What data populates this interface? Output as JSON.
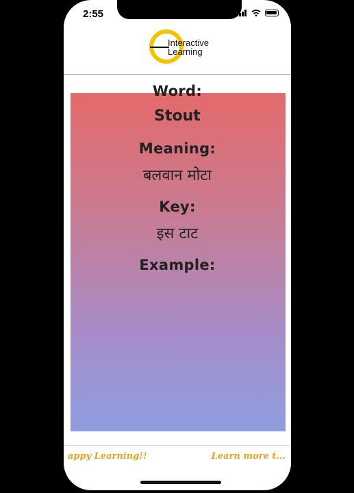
{
  "status_bar": {
    "time": "2:55",
    "icons": [
      "signal-icon",
      "wifi-icon",
      "battery-icon"
    ]
  },
  "header": {
    "logo_icon": "interactive-learning-logo",
    "logo_line1": "Interactive",
    "logo_line2": "Learning",
    "logo_ring_color": "#f5c400"
  },
  "card": {
    "word_label": "Word:",
    "word_value": "Stout",
    "meaning_label": "Meaning:",
    "meaning_value": "बलवान मोटा",
    "key_label": "Key:",
    "key_value": "इस टाट",
    "example_label": "Example:",
    "example_value": "",
    "gradient_top": "#e46a6b",
    "gradient_bottom": "#8f9de0"
  },
  "footer": {
    "left_text": "appy Learning!!",
    "right_text": "Learn more t...",
    "text_color": "#e8a21a"
  }
}
